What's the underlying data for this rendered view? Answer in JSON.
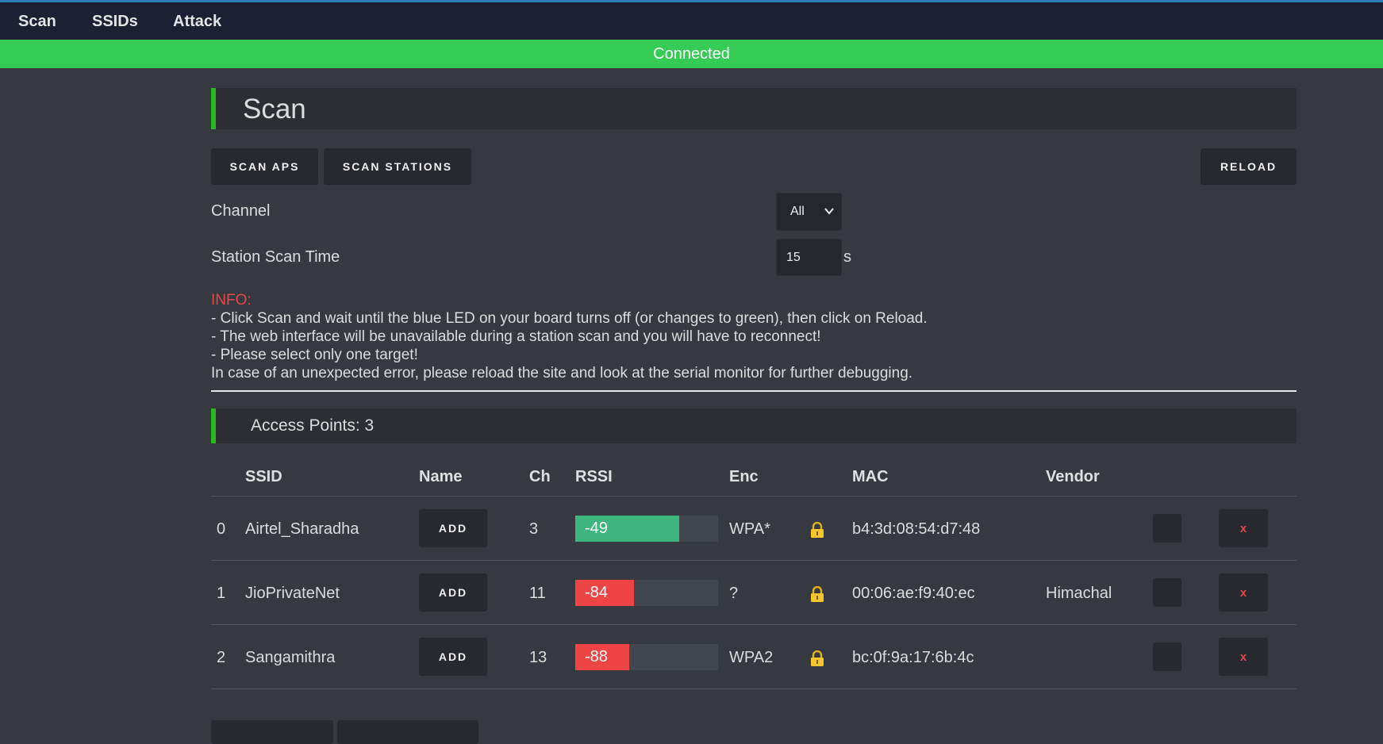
{
  "nav": {
    "items": [
      "Scan",
      "SSIDs",
      "Attack"
    ]
  },
  "status": "Connected",
  "page_title": "Scan",
  "buttons": {
    "scan_aps": "SCAN APS",
    "scan_stations": "SCAN STATIONS",
    "reload": "RELOAD"
  },
  "channel": {
    "label": "Channel",
    "value": "All"
  },
  "station_scan": {
    "label": "Station Scan Time",
    "value": "15",
    "unit": "s"
  },
  "info": {
    "heading": "INFO:",
    "lines": [
      "- Click Scan and wait until the blue LED on your board turns off (or changes to green), then click on Reload.",
      "- The web interface will be unavailable during a station scan and you will have to reconnect!",
      "- Please select only one target!",
      "In case of an unexpected error, please reload the site and look at the serial monitor for further debugging."
    ]
  },
  "access_points": {
    "title": "Access Points: 3",
    "headers": {
      "ssid": "SSID",
      "name": "Name",
      "ch": "Ch",
      "rssi": "RSSI",
      "enc": "Enc",
      "mac": "MAC",
      "vendor": "Vendor"
    },
    "rows": [
      {
        "index": "0",
        "ssid": "Airtel_Sharadha",
        "add": "ADD",
        "ch": "3",
        "rssi": "-49",
        "rssi_level": 0.73,
        "rssi_color": "#3fb57e",
        "enc": "WPA*",
        "mac": "b4:3d:08:54:d7:48",
        "vendor": "",
        "remove": "x"
      },
      {
        "index": "1",
        "ssid": "JioPrivateNet",
        "add": "ADD",
        "ch": "11",
        "rssi": "-84",
        "rssi_level": 0.41,
        "rssi_color": "#ee4444",
        "enc": "?",
        "mac": "00:06:ae:f9:40:ec",
        "vendor": "Himachal",
        "remove": "x"
      },
      {
        "index": "2",
        "ssid": "Sangamithra",
        "add": "ADD",
        "ch": "13",
        "rssi": "-88",
        "rssi_level": 0.38,
        "rssi_color": "#ee4444",
        "enc": "WPA2",
        "mac": "bc:0f:9a:17:6b:4c",
        "vendor": "",
        "remove": "x"
      }
    ]
  }
}
